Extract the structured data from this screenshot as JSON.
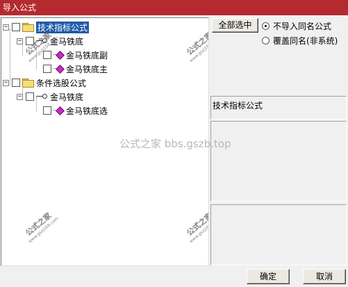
{
  "window": {
    "title": "导入公式"
  },
  "tree": {
    "nodes": [
      {
        "label": "技术指标公式"
      },
      {
        "label": "金马铁底"
      },
      {
        "label": "金马铁底副"
      },
      {
        "label": "金马铁底主"
      },
      {
        "label": "条件选股公式"
      },
      {
        "label": "金马铁底"
      },
      {
        "label": "金马铁底选"
      }
    ]
  },
  "options": {
    "select_all_label": "全部选中",
    "radio_skip_label": "不导入同名公式",
    "radio_overwrite_label": "覆盖同名(非系统)"
  },
  "detail": {
    "title": "技术指标公式"
  },
  "watermark": {
    "text": "公式之家 bbs.gszb.top"
  },
  "stamp": {
    "main": "公式之家",
    "url": "www.gszj168.com"
  },
  "buttons": {
    "ok_label": "确定",
    "cancel_label": "取消"
  },
  "colors": {
    "titlebar": "#b42a2f",
    "selection": "#1f5aa8"
  }
}
